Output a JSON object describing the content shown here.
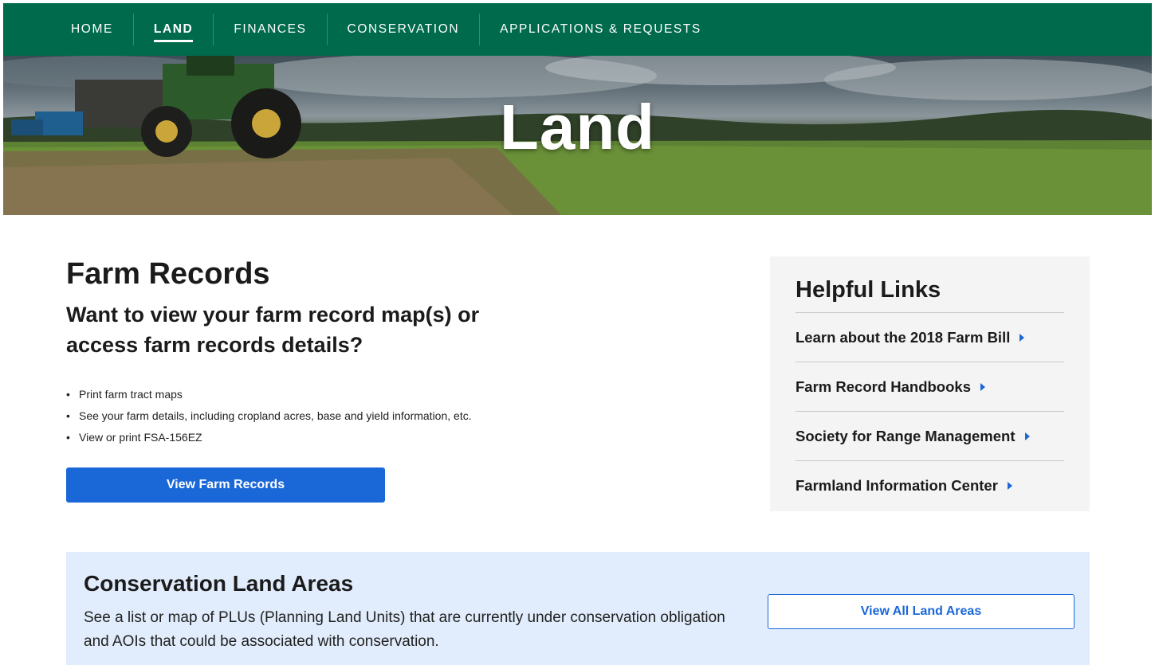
{
  "nav": {
    "items": [
      {
        "label": "HOME",
        "active": false
      },
      {
        "label": "LAND",
        "active": true
      },
      {
        "label": "FINANCES",
        "active": false
      },
      {
        "label": "CONSERVATION",
        "active": false
      },
      {
        "label": "APPLICATIONS & REQUESTS",
        "active": false
      }
    ]
  },
  "hero": {
    "title": "Land"
  },
  "farm_records": {
    "title": "Farm Records",
    "subtitle": "Want to view your farm record map(s) or access farm records details?",
    "bullets": [
      "Print farm tract maps",
      "See your farm details, including cropland acres, base and yield information, etc.",
      "View or print FSA-156EZ"
    ],
    "button_label": "View Farm Records"
  },
  "helpful_links": {
    "title": "Helpful Links",
    "links": [
      "Learn about the 2018 Farm Bill",
      "Farm Record Handbooks",
      "Society for Range Management",
      "Farmland Information Center"
    ]
  },
  "conservation": {
    "title": "Conservation Land Areas",
    "description": "See a list or map of PLUs (Planning Land Units) that are currently under conservation obligation and AOIs that could be associated with conservation.",
    "button_label": "View All Land Areas"
  },
  "colors": {
    "nav_green": "#006a4d",
    "primary_blue": "#1a67d8",
    "panel_gray": "#f4f4f4",
    "callout_blue": "#e1edfc"
  }
}
